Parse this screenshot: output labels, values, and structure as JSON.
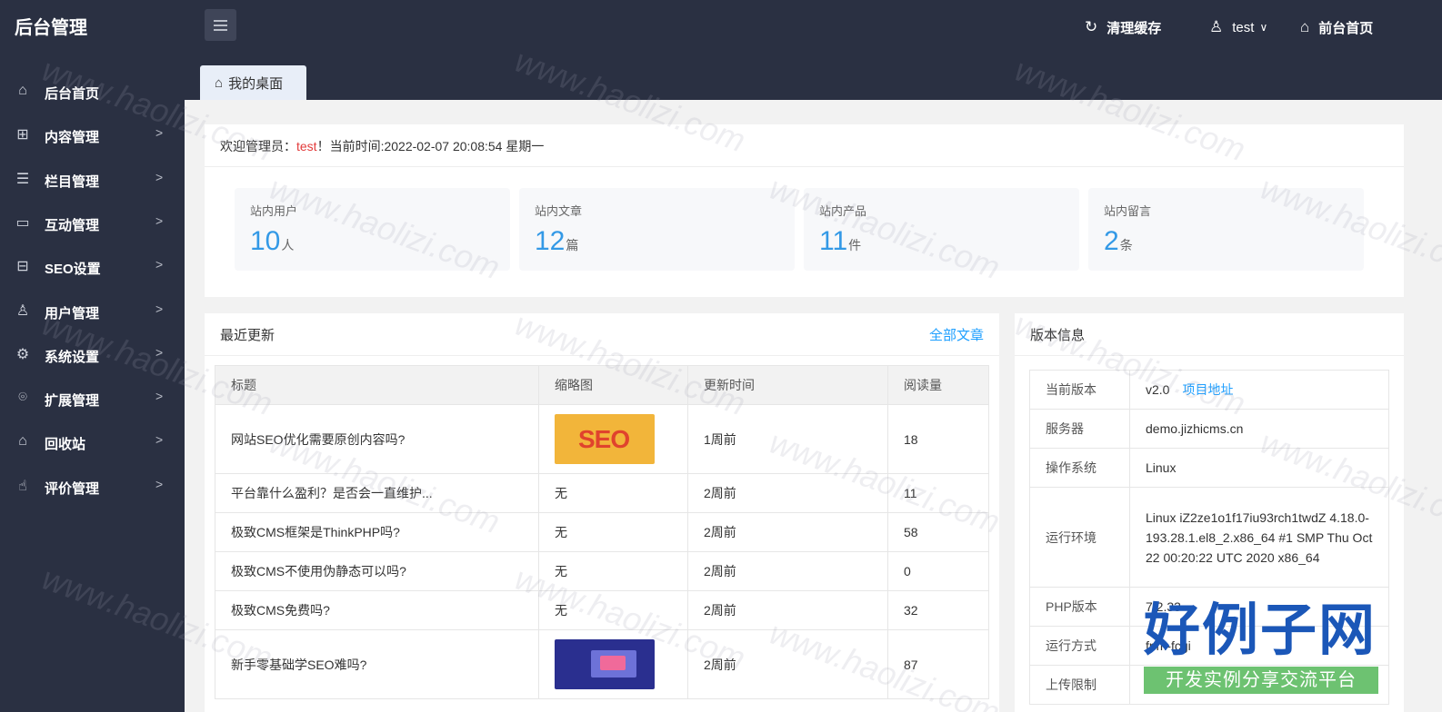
{
  "header": {
    "logo": "后台管理",
    "clear_cache": "清理缓存",
    "user": "test",
    "front_home": "前台首页"
  },
  "sidebar": {
    "items": [
      {
        "label": "后台首页",
        "icon": "home-icon",
        "glyph": "⌂",
        "arrow": ""
      },
      {
        "label": "内容管理",
        "icon": "grid-icon",
        "glyph": "⊞",
        "arrow": ">"
      },
      {
        "label": "栏目管理",
        "icon": "list-icon",
        "glyph": "☰",
        "arrow": ">"
      },
      {
        "label": "互动管理",
        "icon": "chat-icon",
        "glyph": "▭",
        "arrow": ">"
      },
      {
        "label": "SEO设置",
        "icon": "screen-icon",
        "glyph": "⊟",
        "arrow": ">"
      },
      {
        "label": "用户管理",
        "icon": "user-icon",
        "glyph": "♙",
        "arrow": ">"
      },
      {
        "label": "系统设置",
        "icon": "gear-icon",
        "glyph": "⚙",
        "arrow": ">"
      },
      {
        "label": "扩展管理",
        "icon": "extension-icon",
        "glyph": "⌾",
        "arrow": ">"
      },
      {
        "label": "回收站",
        "icon": "recycle-icon",
        "glyph": "⌂",
        "arrow": ">"
      },
      {
        "label": "评价管理",
        "icon": "thumbs-up-icon",
        "glyph": "☝",
        "arrow": ">"
      }
    ]
  },
  "tab": {
    "label": "我的桌面"
  },
  "welcome": {
    "prefix": "欢迎管理员：",
    "user": "test",
    "suffix": "！当前时间:2022-02-07 20:08:54 星期一"
  },
  "stats": [
    {
      "label": "站内用户",
      "value": "10",
      "unit": "人"
    },
    {
      "label": "站内文章",
      "value": "12",
      "unit": "篇"
    },
    {
      "label": "站内产品",
      "value": "11",
      "unit": "件"
    },
    {
      "label": "站内留言",
      "value": "2",
      "unit": "条"
    }
  ],
  "recent": {
    "title": "最近更新",
    "link": "全部文章",
    "columns": [
      "标题",
      "缩略图",
      "更新时间",
      "阅读量"
    ],
    "rows": [
      {
        "title": "网站SEO优化需要原创内容吗?",
        "thumb": "seo-image",
        "time": "1周前",
        "views": "18"
      },
      {
        "title": "平台靠什么盈利？是否会一直维护...",
        "thumb": "无",
        "time": "2周前",
        "views": "11"
      },
      {
        "title": "极致CMS框架是ThinkPHP吗?",
        "thumb": "无",
        "time": "2周前",
        "views": "58"
      },
      {
        "title": "极致CMS不使用伪静态可以吗?",
        "thumb": "无",
        "time": "2周前",
        "views": "0"
      },
      {
        "title": "极致CMS免费吗?",
        "thumb": "无",
        "time": "2周前",
        "views": "32"
      },
      {
        "title": "新手零基础学SEO难吗?",
        "thumb": "learning-image",
        "time": "2周前",
        "views": "87"
      }
    ],
    "thumb_text": "SEO"
  },
  "version": {
    "title": "版本信息",
    "rows": [
      {
        "key": "当前版本",
        "value": "v2.0",
        "link": "项目地址"
      },
      {
        "key": "服务器",
        "value": "demo.jizhicms.cn"
      },
      {
        "key": "操作系统",
        "value": "Linux"
      },
      {
        "key": "运行环境",
        "value": "Linux iZ2ze1o1f17iu93rch1twdZ 4.18.0-193.28.1.el8_2.x86_64 #1 SMP Thu Oct 22 00:20:22 UTC 2020 x86_64"
      },
      {
        "key": "PHP版本",
        "value": "7.2.33"
      },
      {
        "key": "运行方式",
        "value": "fpm-fcgi"
      },
      {
        "key": "上传限制",
        "value": ""
      }
    ]
  },
  "watermark": {
    "text": "www.haolizi.com",
    "logo_main": "好例子网",
    "logo_sub": "开发实例分享交流平台"
  }
}
